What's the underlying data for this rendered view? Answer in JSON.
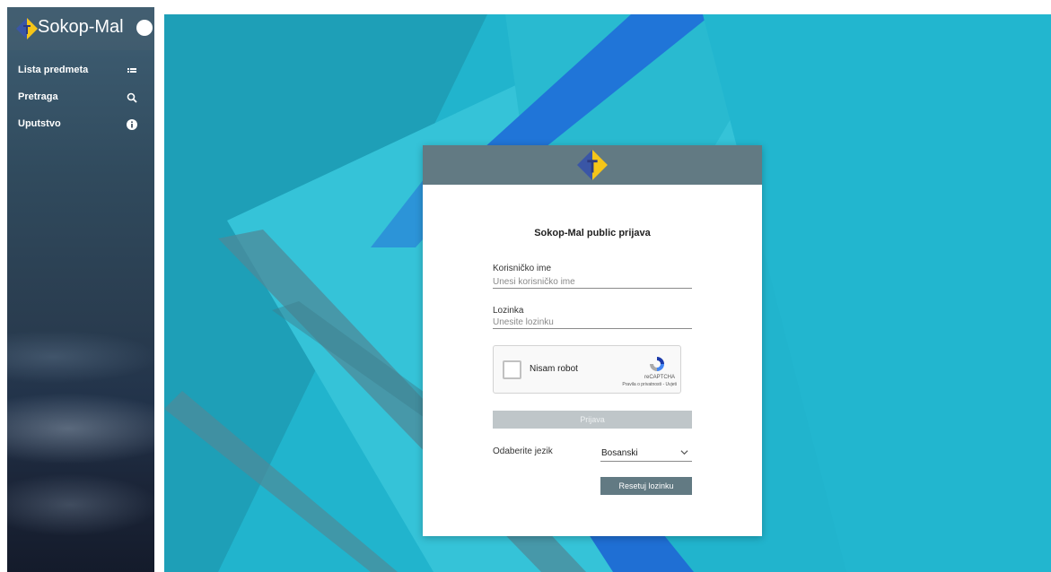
{
  "sidebar": {
    "brand": "Sokop-Mal",
    "items": [
      {
        "label": "Lista predmeta",
        "icon": "list-icon"
      },
      {
        "label": "Pretraga",
        "icon": "search-icon"
      },
      {
        "label": "Uputstvo",
        "icon": "info-icon"
      }
    ]
  },
  "login": {
    "title": "Sokop-Mal public prijava",
    "username_label": "Korisničko ime",
    "username_placeholder": "Unesi korisničko ime",
    "password_label": "Lozinka",
    "password_placeholder": "Unesite lozinku",
    "captcha": {
      "label": "Nisam robot",
      "brand": "reCAPTCHA",
      "links": "Pravila o privatnosti - Uvjeti"
    },
    "login_button": "Prijava",
    "language_label": "Odaberite jezik",
    "language_value": "Bosanski",
    "reset_button": "Resetuj lozinku"
  },
  "colors": {
    "background": "#21b4cd",
    "card_header": "#627a83",
    "logo_blue": "#3a56a6",
    "logo_yellow": "#f5c518"
  }
}
